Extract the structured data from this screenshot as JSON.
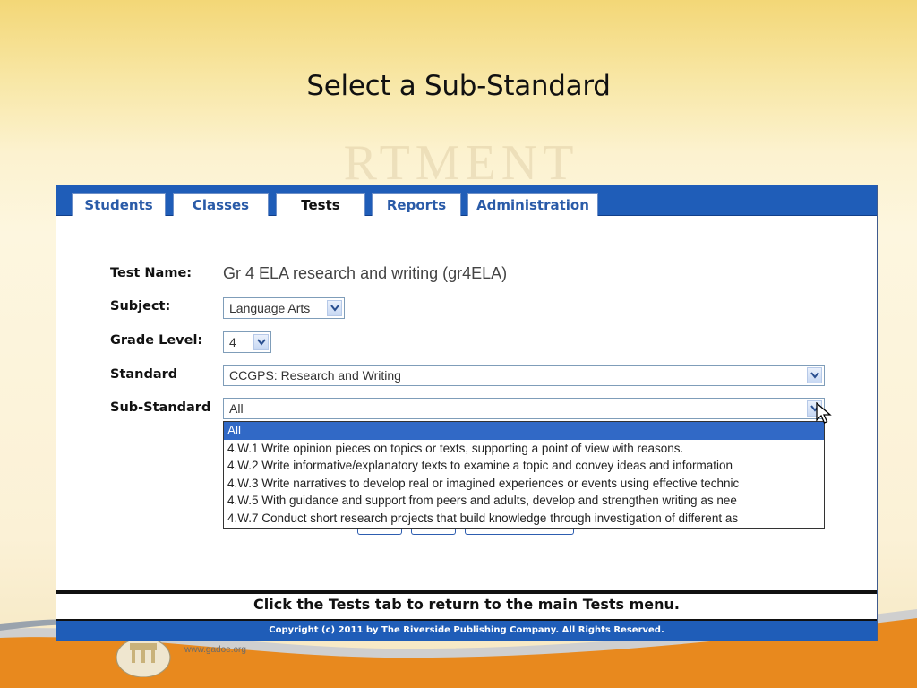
{
  "slide": {
    "title": "Select a Sub-Standard",
    "watermark": "RTMENT",
    "footer_url": "www.gadoe.org"
  },
  "tabs": [
    {
      "label": "Students",
      "active": false
    },
    {
      "label": "Classes",
      "active": false
    },
    {
      "label": "Tests",
      "active": true
    },
    {
      "label": "Reports",
      "active": false
    },
    {
      "label": "Administration",
      "active": false
    }
  ],
  "form": {
    "test_name_label": "Test Name:",
    "test_name_value": "Gr 4 ELA research and writing (gr4ELA)",
    "subject_label": "Subject:",
    "subject_value": "Language Arts",
    "grade_label": "Grade Level:",
    "grade_value": "4",
    "standard_label": "Standard",
    "standard_value": "CCGPS: Research and Writing",
    "substandard_label": "Sub-Standard",
    "substandard_value": "All"
  },
  "substandard_options": [
    "All",
    "4.W.1 Write opinion pieces on topics or texts, supporting a point of view with reasons.",
    "4.W.2 Write informative/explanatory texts to examine a topic and convey ideas and information",
    "4.W.3 Write narratives to develop real or imagined experiences or events using effective technic",
    "4.W.5 With guidance and support from peers and adults, develop and strengthen writing as nee",
    "4.W.7 Conduct short research projects that build knowledge through investigation of different as"
  ],
  "footer": {
    "return_message": "Click the Tests tab to return to the main Tests menu.",
    "copyright": "Copyright (c) 2011 by The Riverside Publishing Company. All Rights Reserved."
  },
  "colors": {
    "tab_bar": "#1f5db8",
    "tab_text": "#2a5ba8",
    "selected_option": "#3169c6"
  }
}
